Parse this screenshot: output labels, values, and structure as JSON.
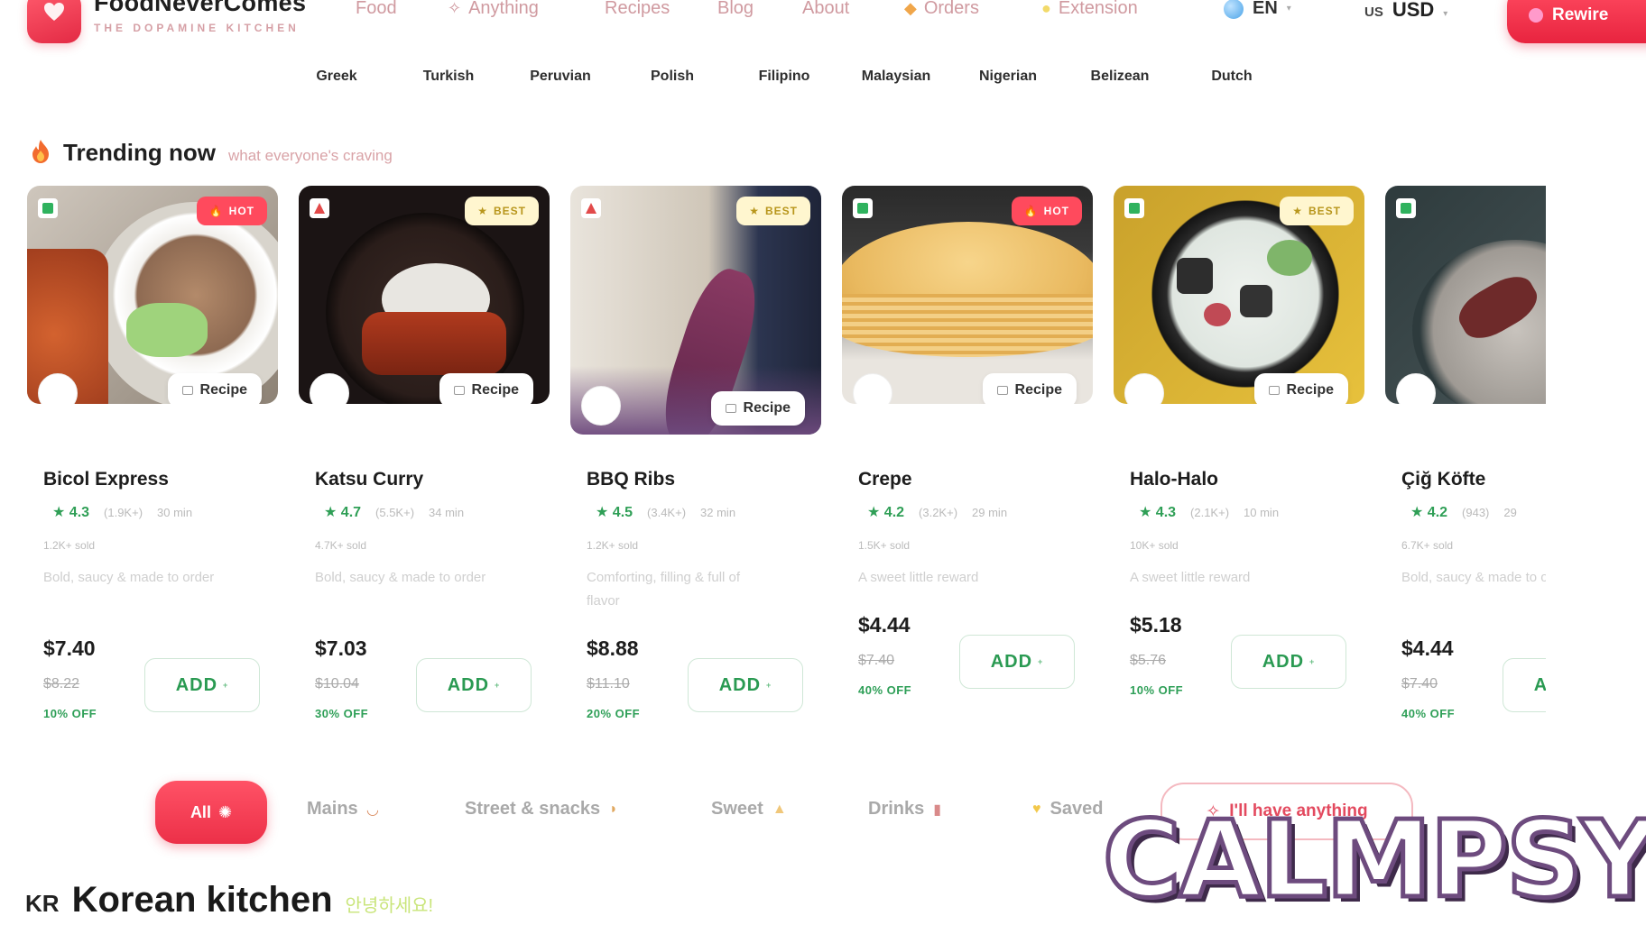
{
  "header": {
    "brand_name": "FoodNeverComes",
    "brand_tagline": "THE DOPAMINE KITCHEN",
    "nav": [
      {
        "label": "Food",
        "icon": ""
      },
      {
        "label": "Anything",
        "icon": "sparkle-icon"
      },
      {
        "label": "Recipes",
        "icon": ""
      },
      {
        "label": "Blog",
        "icon": ""
      },
      {
        "label": "About",
        "icon": ""
      },
      {
        "label": "Orders",
        "icon": "bag-icon"
      },
      {
        "label": "Extension",
        "icon": "puzzle-icon"
      }
    ],
    "language": "EN",
    "currency_code": "US",
    "currency": "USD",
    "cta_label": "Rewire"
  },
  "cuisines": [
    "Greek",
    "Turkish",
    "Peruvian",
    "Polish",
    "Filipino",
    "Malaysian",
    "Nigerian",
    "Belizean",
    "Dutch"
  ],
  "trending": {
    "title": "Trending now",
    "subtitle": "what everyone's craving"
  },
  "cards": [
    {
      "name": "Bicol Express",
      "badge": "HOT",
      "rating": "★ 4.3",
      "reviews": "(1.9K+)",
      "time": "30 min",
      "sold": "1.2K+ sold",
      "desc": "Bold, saucy & made to order",
      "price": "$7.40",
      "old_price": "$8.22",
      "discount": "10% OFF",
      "add_label": "ADD",
      "recipe_label": "Recipe"
    },
    {
      "name": "Katsu Curry",
      "badge": "BEST",
      "rating": "★ 4.7",
      "reviews": "(5.5K+)",
      "time": "34 min",
      "sold": "4.7K+ sold",
      "desc": "Bold, saucy & made to order",
      "price": "$7.03",
      "old_price": "$10.04",
      "discount": "30% OFF",
      "add_label": "ADD",
      "recipe_label": "Recipe"
    },
    {
      "name": "BBQ Ribs",
      "badge": "BEST",
      "rating": "★ 4.5",
      "reviews": "(3.4K+)",
      "time": "32 min",
      "sold": "1.2K+ sold",
      "desc": "Comforting, filling & full of flavor",
      "price": "$8.88",
      "old_price": "$11.10",
      "discount": "20% OFF",
      "add_label": "ADD",
      "recipe_label": "Recipe"
    },
    {
      "name": "Crepe",
      "badge": "HOT",
      "rating": "★ 4.2",
      "reviews": "(3.2K+)",
      "time": "29 min",
      "sold": "1.5K+ sold",
      "desc": "A sweet little reward",
      "price": "$4.44",
      "old_price": "$7.40",
      "discount": "40% OFF",
      "add_label": "ADD",
      "recipe_label": "Recipe"
    },
    {
      "name": "Halo-Halo",
      "badge": "BEST",
      "rating": "★ 4.3",
      "reviews": "(2.1K+)",
      "time": "10 min",
      "sold": "10K+ sold",
      "desc": "A sweet little reward",
      "price": "$5.18",
      "old_price": "$5.76",
      "discount": "10% OFF",
      "add_label": "ADD",
      "recipe_label": "Recipe"
    },
    {
      "name": "Çiğ Köfte",
      "badge": "",
      "rating": "★ 4.2",
      "reviews": "(943)",
      "time": "29",
      "sold": "6.7K+ sold",
      "desc": "Bold, saucy & made to order",
      "price": "$4.44",
      "old_price": "$7.40",
      "discount": "40% OFF",
      "add_label": "ADD",
      "recipe_label": ""
    }
  ],
  "tabs": {
    "all": "All",
    "mains": "Mains",
    "street": "Street & snacks",
    "sweet": "Sweet",
    "drinks": "Drinks",
    "saved": "Saved",
    "anything": "I'll have anything"
  },
  "section": {
    "code": "KR",
    "title": "Korean kitchen",
    "subtitle": "안녕하세요!"
  },
  "watermark": "CALMPSY",
  "colors": {
    "brand_red": "#ec3048",
    "rating_green": "#2f9f56",
    "muted_pink": "#d09aa0"
  }
}
